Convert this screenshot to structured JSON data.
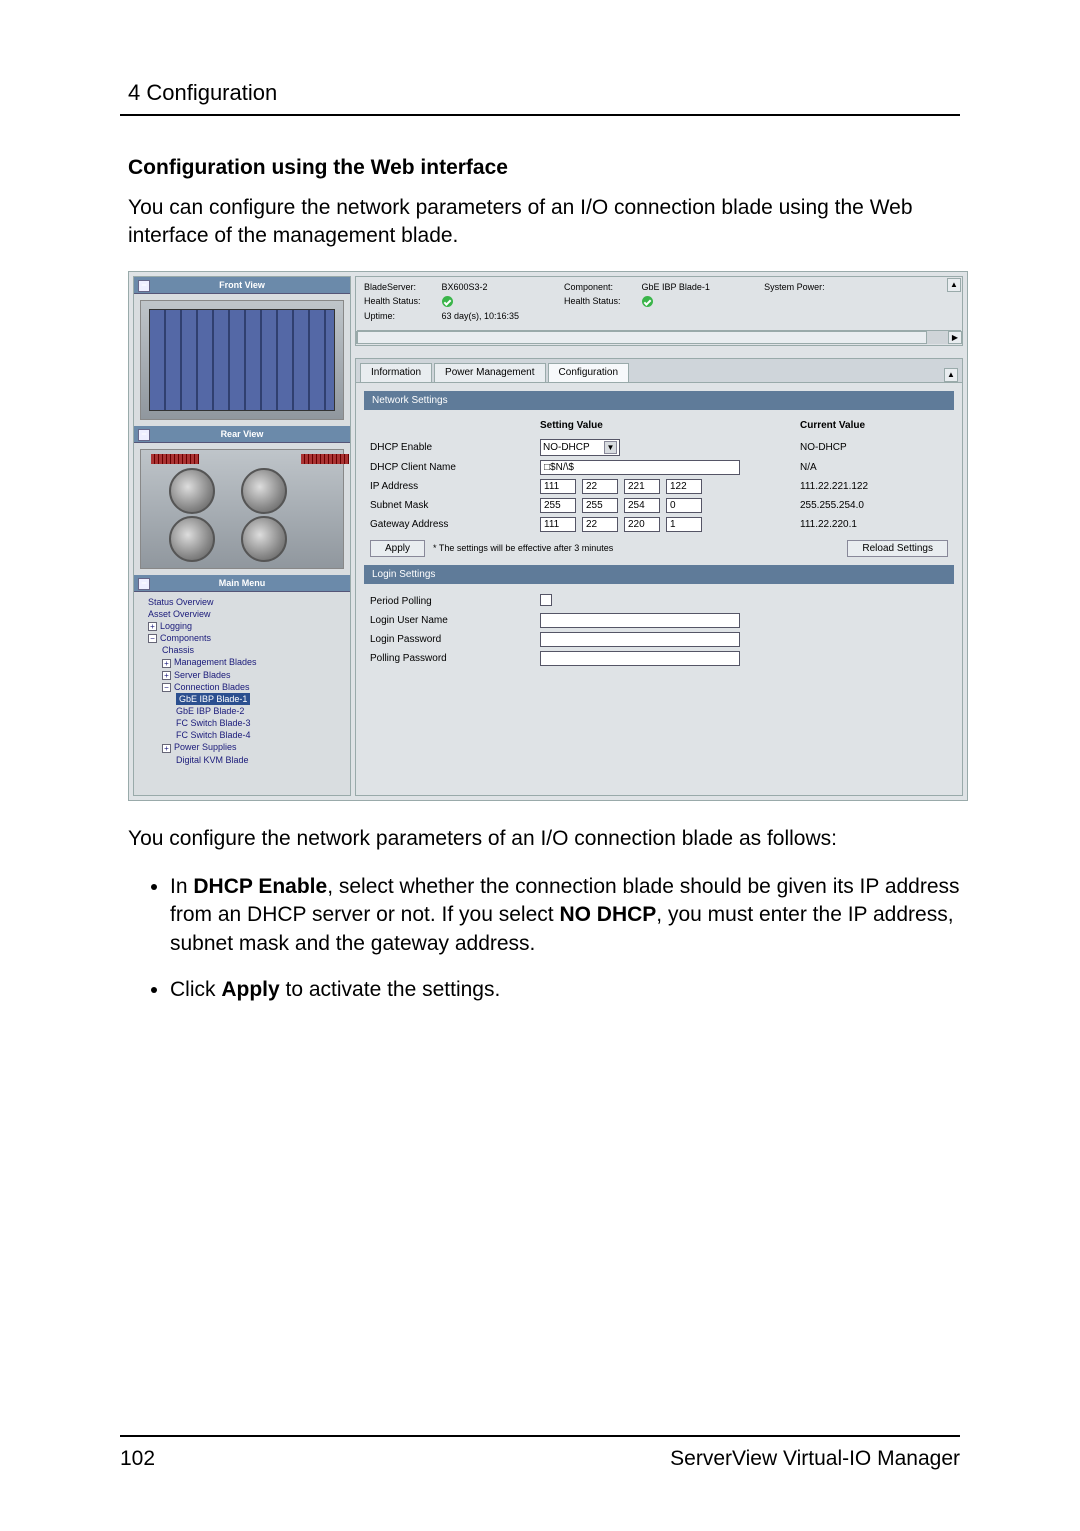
{
  "doc": {
    "section_num_title": "4 Configuration",
    "heading": "Configuration using the Web interface",
    "intro": "You can configure the network parameters of an I/O connection blade using the Web interface of the management blade.",
    "after_img": "You configure the network parameters of an I/O connection blade as follows:",
    "bullet1_pre": "In ",
    "bullet1_b1": "DHCP Enable",
    "bullet1_mid": ", select whether the connection blade should be given its IP address from an DHCP server or not. If you select ",
    "bullet1_b2": "NO DHCP",
    "bullet1_post": ", you must enter the IP address, subnet mask and the gateway address.",
    "bullet2_pre": "Click ",
    "bullet2_b": "Apply",
    "bullet2_post": " to activate the settings.",
    "page_num": "102",
    "footer_right": "ServerView Virtual-IO Manager"
  },
  "ui": {
    "left": {
      "front_title": "Front View",
      "rear_title": "Rear View",
      "menu_title": "Main Menu",
      "items": {
        "status": "Status Overview",
        "asset": "Asset Overview",
        "logging": "Logging",
        "components": "Components",
        "chassis": "Chassis",
        "mgmt": "Management Blades",
        "server": "Server Blades",
        "conn": "Connection Blades",
        "gbe1": "GbE IBP Blade-1",
        "gbe2": "GbE IBP Blade-2",
        "fc3": "FC Switch Blade-3",
        "fc4": "FC Switch Blade-4",
        "power": "Power Supplies",
        "kvm": "Digital KVM Blade"
      },
      "minus": "−",
      "plus": "+"
    },
    "info": {
      "blade_server_l": "BladeServer:",
      "blade_server_v": "BX600S3-2",
      "component_l": "Component:",
      "component_v": "GbE IBP Blade-1",
      "syspower_l": "System Power:",
      "health_l": "Health Status:",
      "uptime_l": "Uptime:",
      "uptime_v": "63 day(s), 10:16:35",
      "arrow_left": "◀",
      "arrow_right": "▶",
      "arrow_up": "▲",
      "arrow_down": "▼"
    },
    "tabs": {
      "t1": "Information",
      "t2": "Power Management",
      "t3": "Configuration"
    },
    "net": {
      "section": "Network Settings",
      "col_setting": "Setting Value",
      "col_current": "Current Value",
      "dhcp_l": "DHCP Enable",
      "dhcp_sel": "NO-DHCP",
      "dhcp_cur": "NO-DHCP",
      "client_l": "DHCP Client Name",
      "client_v": "□$N/\\$",
      "client_cur": "N/A",
      "ip_l": "IP Address",
      "ip": [
        "111",
        "22",
        "221",
        "122"
      ],
      "ip_cur": "111.22.221.122",
      "mask_l": "Subnet Mask",
      "mask": [
        "255",
        "255",
        "254",
        "0"
      ],
      "mask_cur": "255.255.254.0",
      "gw_l": "Gateway Address",
      "gw": [
        "111",
        "22",
        "220",
        "1"
      ],
      "gw_cur": "111.22.220.1",
      "apply": "Apply",
      "note": "* The settings will be effective after 3 minutes",
      "reload": "Reload Settings"
    },
    "login": {
      "section": "Login Settings",
      "period_l": "Period Polling",
      "user_l": "Login User Name",
      "pass_l": "Login Password",
      "pollpass_l": "Polling Password"
    }
  }
}
